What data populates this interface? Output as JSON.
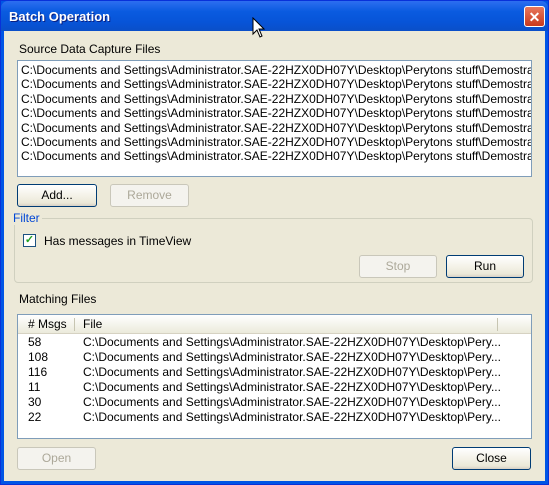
{
  "window": {
    "title": "Batch Operation",
    "close_glyph": "✕"
  },
  "source": {
    "label": "Source Data Capture Files",
    "files": [
      "C:\\Documents and Settings\\Administrator.SAE-22HZX0DH07Y\\Desktop\\Perytons stuff\\Demostrati",
      "C:\\Documents and Settings\\Administrator.SAE-22HZX0DH07Y\\Desktop\\Perytons stuff\\Demostrati",
      "C:\\Documents and Settings\\Administrator.SAE-22HZX0DH07Y\\Desktop\\Perytons stuff\\Demostrati",
      "C:\\Documents and Settings\\Administrator.SAE-22HZX0DH07Y\\Desktop\\Perytons stuff\\Demostrati",
      "C:\\Documents and Settings\\Administrator.SAE-22HZX0DH07Y\\Desktop\\Perytons stuff\\Demostrati",
      "C:\\Documents and Settings\\Administrator.SAE-22HZX0DH07Y\\Desktop\\Perytons stuff\\Demostrati",
      "C:\\Documents and Settings\\Administrator.SAE-22HZX0DH07Y\\Desktop\\Perytons stuff\\Demostrati"
    ],
    "add_label": "Add...",
    "remove_label": "Remove"
  },
  "filter": {
    "group_label": "Filter",
    "checkbox_label": "Has messages in TimeView",
    "checkbox_checked": true,
    "checkbox_glyph": "✓",
    "stop_label": "Stop",
    "run_label": "Run"
  },
  "matching": {
    "label": "Matching Files",
    "columns": [
      "# Msgs",
      "File"
    ],
    "rows": [
      {
        "msgs": "58",
        "file": "C:\\Documents and Settings\\Administrator.SAE-22HZX0DH07Y\\Desktop\\Pery..."
      },
      {
        "msgs": "108",
        "file": "C:\\Documents and Settings\\Administrator.SAE-22HZX0DH07Y\\Desktop\\Pery..."
      },
      {
        "msgs": "116",
        "file": "C:\\Documents and Settings\\Administrator.SAE-22HZX0DH07Y\\Desktop\\Pery..."
      },
      {
        "msgs": "11",
        "file": "C:\\Documents and Settings\\Administrator.SAE-22HZX0DH07Y\\Desktop\\Pery..."
      },
      {
        "msgs": "30",
        "file": "C:\\Documents and Settings\\Administrator.SAE-22HZX0DH07Y\\Desktop\\Pery..."
      },
      {
        "msgs": "22",
        "file": "C:\\Documents and Settings\\Administrator.SAE-22HZX0DH07Y\\Desktop\\Pery..."
      }
    ]
  },
  "footer": {
    "open_label": "Open",
    "close_label": "Close"
  },
  "colors": {
    "titlebar": "#0a5be0",
    "face": "#ece9d8",
    "border": "#7f9db9",
    "filter_title": "#0046d5"
  }
}
